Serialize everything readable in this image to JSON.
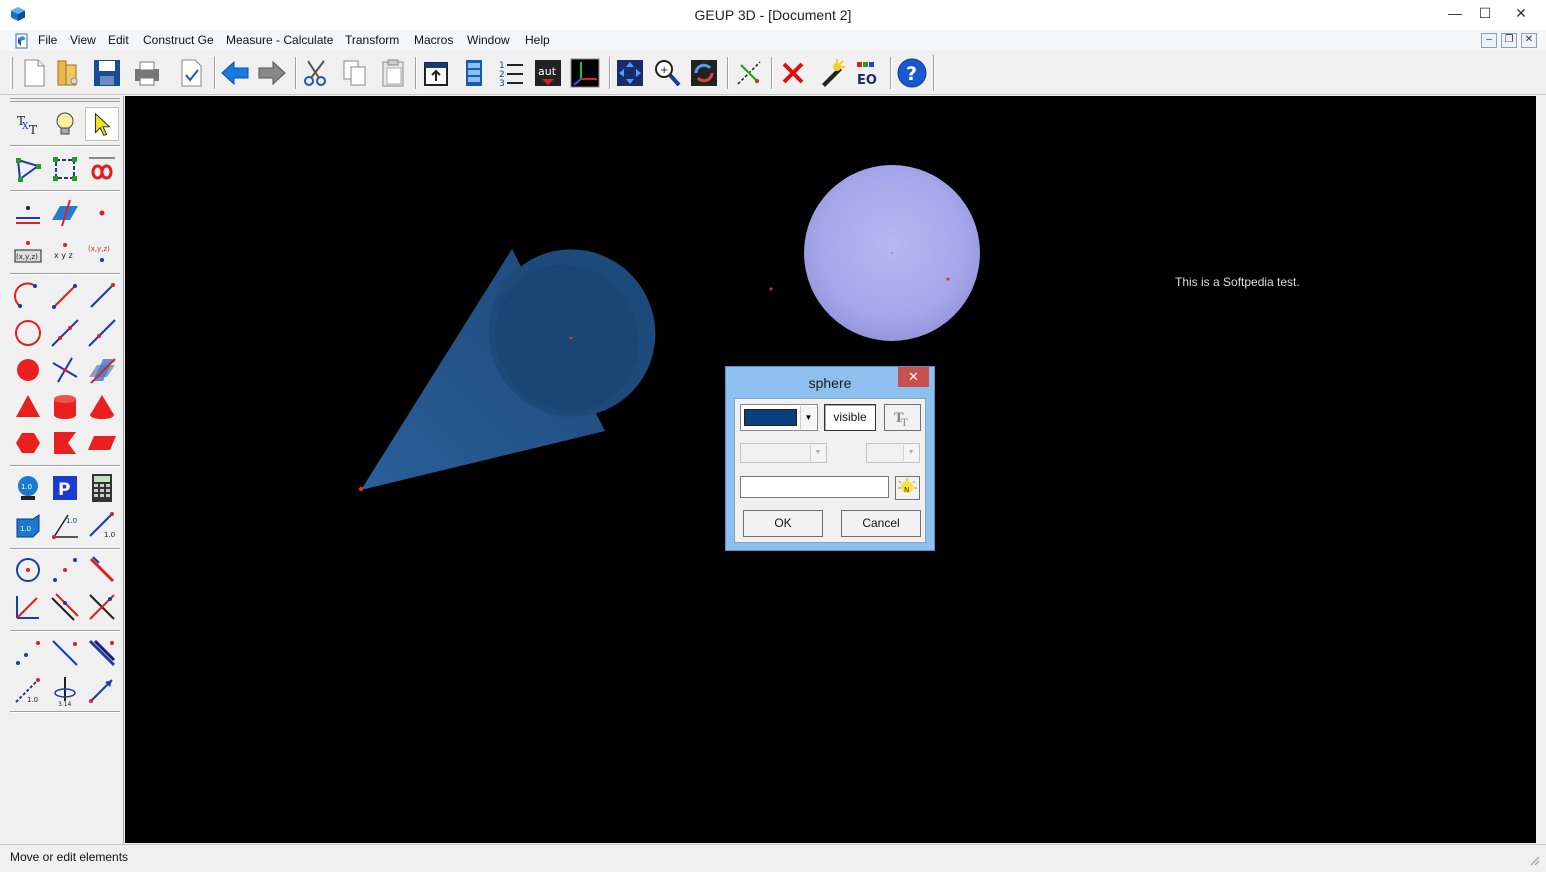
{
  "window": {
    "title": "GEUP 3D - [Document 2]",
    "minimize": "—",
    "maximize": "☐",
    "close": "✕"
  },
  "menu": {
    "items": [
      "File",
      "View",
      "Edit",
      "Construct Ge",
      "Measure - Calculate",
      "Transform",
      "Macros",
      "Window",
      "Help"
    ]
  },
  "toolbar": {
    "icons": [
      "new-document-icon",
      "open-folder-icon",
      "save-icon",
      "print-icon",
      "print-preview-icon",
      "undo-arrow-icon",
      "redo-arrow-icon",
      "cut-icon",
      "copy-icon",
      "paste-icon",
      "window-icon",
      "animation-icon",
      "numbered-list-icon",
      "auto-icon",
      "axes-icon",
      "fit-view-icon",
      "zoom-icon",
      "rotate-icon",
      "trace-icon",
      "delete-icon",
      "light-icon",
      "eo-icon",
      "help-icon"
    ]
  },
  "canvas": {
    "text": "This is a Softpedia test."
  },
  "dialog": {
    "title": "sphere",
    "close": "✕",
    "visible_label": "visible",
    "name_value": "",
    "ok_label": "OK",
    "cancel_label": "Cancel",
    "color": "#0b3f7e"
  },
  "status": {
    "text": "Move or edit elements"
  },
  "colors": {
    "canvas_bg": "#000000",
    "cone": "#1e4a7a",
    "sphere": "#a7a8ea",
    "point": "#ff2020"
  }
}
